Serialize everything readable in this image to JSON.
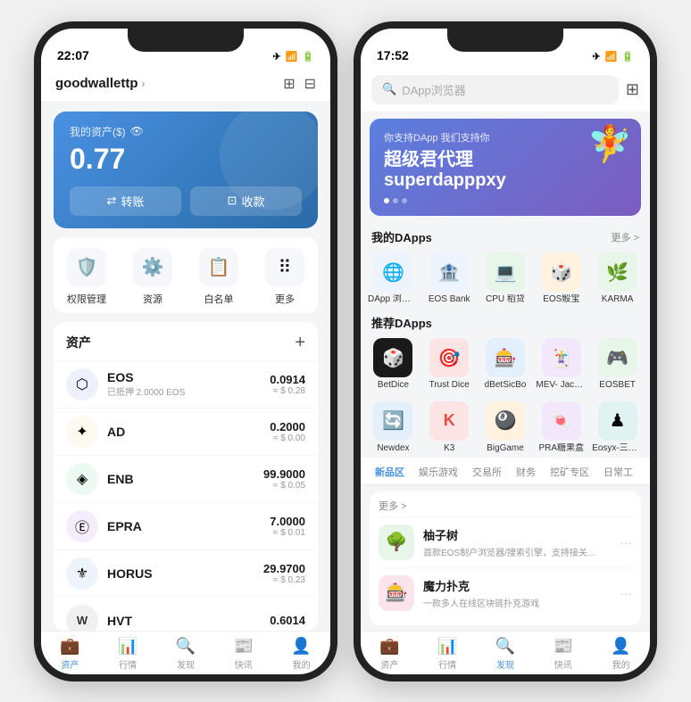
{
  "left_phone": {
    "status_time": "22:07",
    "wallet_name": "goodwallettp",
    "asset_label": "我的资产($)",
    "asset_amount": "0.77",
    "btn_transfer": "转账",
    "btn_receive": "收款",
    "quick_actions": [
      {
        "icon": "🛡️",
        "label": "权限管理"
      },
      {
        "icon": "⚙️",
        "label": "资源"
      },
      {
        "icon": "📋",
        "label": "白名单"
      },
      {
        "icon": "⠿",
        "label": "更多"
      }
    ],
    "assets_title": "资产",
    "assets": [
      {
        "symbol": "EOS",
        "sub": "已抵押 2.0000 EOS",
        "amount": "0.0914",
        "usd": "≈ $ 0.28",
        "color": "#627eea",
        "icon": "⬡"
      },
      {
        "symbol": "AD",
        "sub": "",
        "amount": "0.2000",
        "usd": "≈ $ 0.00",
        "color": "#e8b84b",
        "icon": "✦"
      },
      {
        "symbol": "ENB",
        "sub": "",
        "amount": "99.9000",
        "usd": "≈ $ 0.05",
        "color": "#2ecc71",
        "icon": "◈"
      },
      {
        "symbol": "EPRA",
        "sub": "",
        "amount": "7.0000",
        "usd": "≈ $ 0.01",
        "color": "#9b59b6",
        "icon": "Ⓔ"
      },
      {
        "symbol": "HORUS",
        "sub": "",
        "amount": "29.9700",
        "usd": "≈ $ 0.23",
        "color": "#3498db",
        "icon": "⚜"
      },
      {
        "symbol": "HVT",
        "sub": "",
        "amount": "0.6014",
        "usd": "",
        "color": "#1a1a1a",
        "icon": "W"
      }
    ],
    "nav_items": [
      {
        "label": "资产",
        "active": true,
        "icon": "💼"
      },
      {
        "label": "行情",
        "active": false,
        "icon": "📊"
      },
      {
        "label": "发现",
        "active": false,
        "icon": "🔍"
      },
      {
        "label": "快讯",
        "active": false,
        "icon": "📰"
      },
      {
        "label": "我的",
        "active": false,
        "icon": "👤"
      }
    ]
  },
  "right_phone": {
    "status_time": "17:52",
    "search_placeholder": "DApp浏览器",
    "banner_sub": "你支持DApp 我们支持你",
    "banner_title": "超级君代理",
    "banner_title2": "superdapppxy",
    "my_dapps_title": "我的DApps",
    "my_dapps_more": "更多 >",
    "my_dapps": [
      {
        "label": "DApp\n浏览器",
        "color": "#4a90e2",
        "icon": "🌐"
      },
      {
        "label": "EOS Bank",
        "color": "#3498db",
        "icon": "🏦"
      },
      {
        "label": "CPU 稻贷",
        "color": "#27ae60",
        "icon": "💻"
      },
      {
        "label": "EOS骰宝",
        "color": "#e67e22",
        "icon": "🎲"
      },
      {
        "label": "KARMA",
        "color": "#2ecc71",
        "icon": "🌿"
      }
    ],
    "recommended_title": "推荐DApps",
    "recommended": [
      {
        "label": "BetDice",
        "color": "#1a1a1a",
        "icon": "🎲"
      },
      {
        "label": "Trust Dice",
        "color": "#c0392b",
        "icon": "🎯"
      },
      {
        "label": "dBetSicBo",
        "color": "#2980b9",
        "icon": "🎰"
      },
      {
        "label": "MEV-\nJacksOr...",
        "color": "#8e44ad",
        "icon": "🃏"
      },
      {
        "label": "EOSBET",
        "color": "#27ae60",
        "icon": "🎮"
      },
      {
        "label": "Newdex",
        "color": "#3498db",
        "icon": "🔄"
      },
      {
        "label": "K3",
        "color": "#e74c3c",
        "icon": "K"
      },
      {
        "label": "BigGame",
        "color": "#e67e22",
        "icon": "🎱"
      },
      {
        "label": "PRA糖果盒",
        "color": "#9b59b6",
        "icon": "🍬"
      },
      {
        "label": "Eosyx-三公棋牌",
        "color": "#16a085",
        "icon": "♟"
      }
    ],
    "tabs": [
      "新品区",
      "娱乐游戏",
      "交易所",
      "财务",
      "挖矿专区",
      "日常工"
    ],
    "active_tab": "新品区",
    "new_apps_more": "更多 >",
    "new_apps": [
      {
        "name": "柚子树",
        "desc": "首款EOS制户浏览器/搜索引擎，支持接关...",
        "icon": "🌳",
        "color": "#e8f5e9"
      },
      {
        "name": "魔力扑克",
        "desc": "一款多人在线区块链扑克游戏",
        "icon": "🎰",
        "color": "#fce4ec"
      }
    ],
    "nav_items": [
      {
        "label": "资产",
        "active": false,
        "icon": "💼"
      },
      {
        "label": "行情",
        "active": false,
        "icon": "📊"
      },
      {
        "label": "发现",
        "active": true,
        "icon": "🔍"
      },
      {
        "label": "快讯",
        "active": false,
        "icon": "📰"
      },
      {
        "label": "我的",
        "active": false,
        "icon": "👤"
      }
    ]
  }
}
